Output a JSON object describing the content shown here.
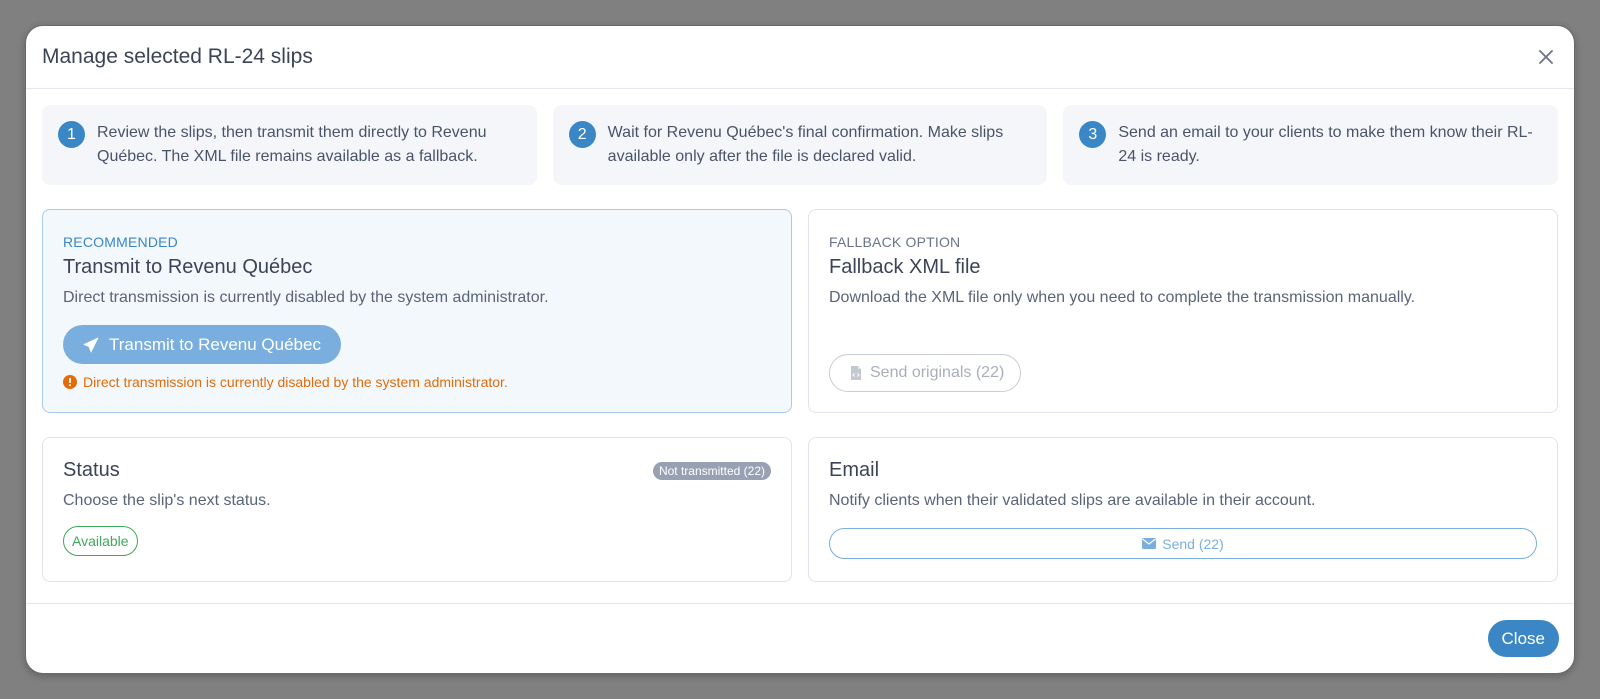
{
  "modal": {
    "title": "Manage selected RL-24 slips",
    "close_icon": "close-icon"
  },
  "steps": [
    {
      "number": "1",
      "text": "Review the slips, then transmit them directly to Revenu Québec. The XML file remains available as a fallback."
    },
    {
      "number": "2",
      "text": "Wait for Revenu Québec's final confirmation. Make slips available only after the file is declared valid."
    },
    {
      "number": "3",
      "text": "Send an email to your clients to make them know their RL-24 is ready."
    }
  ],
  "transmit": {
    "eyebrow": "RECOMMENDED",
    "title": "Transmit to Revenu Québec",
    "description": "Direct transmission is currently disabled by the system administrator.",
    "button_label": "Transmit to Revenu Québec",
    "button_icon": "paper-plane-icon",
    "warning": "Direct transmission is currently disabled by the system administrator.",
    "warning_icon": "exclamation-circle-icon",
    "accent_color": "#3b86c4",
    "warning_color": "#e36c0a"
  },
  "fallback": {
    "eyebrow": "FALLBACK OPTION",
    "title": "Fallback XML file",
    "description": "Download the XML file only when you need to complete the transmission manually.",
    "button_label": "Send originals (22)",
    "button_icon": "file-code-icon"
  },
  "status": {
    "title": "Status",
    "badge": "Not transmitted (22)",
    "description": "Choose the slip's next status.",
    "option_label": "Available",
    "option_color": "#3fa85a"
  },
  "email": {
    "title": "Email",
    "description": "Notify clients when their validated slips are available in their account.",
    "button_label": "Send (22)",
    "button_icon": "envelope-icon"
  },
  "footer": {
    "close_label": "Close"
  }
}
